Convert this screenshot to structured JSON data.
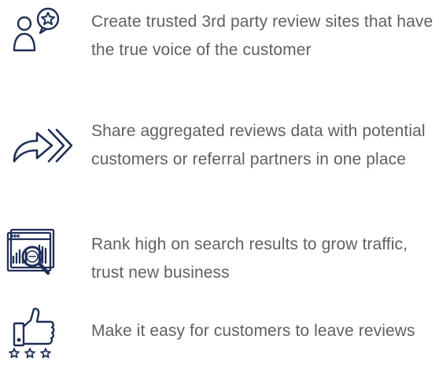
{
  "colors": {
    "icon": "#1e2f57",
    "text": "#5f5f66",
    "background": "#ffffff"
  },
  "features": [
    {
      "icon": "customer-review-star-icon",
      "text": "Create trusted 3rd party review sites that have the true voice of the customer"
    },
    {
      "icon": "share-forward-arrow-icon",
      "text": "Share aggregated reviews data with potential customers or referral partners in one place"
    },
    {
      "icon": "search-ranking-chart-icon",
      "text": "Rank high on search results to grow traffic, trust new business"
    },
    {
      "icon": "thumbs-up-stars-icon",
      "text": "Make it easy for customers to leave reviews"
    }
  ]
}
